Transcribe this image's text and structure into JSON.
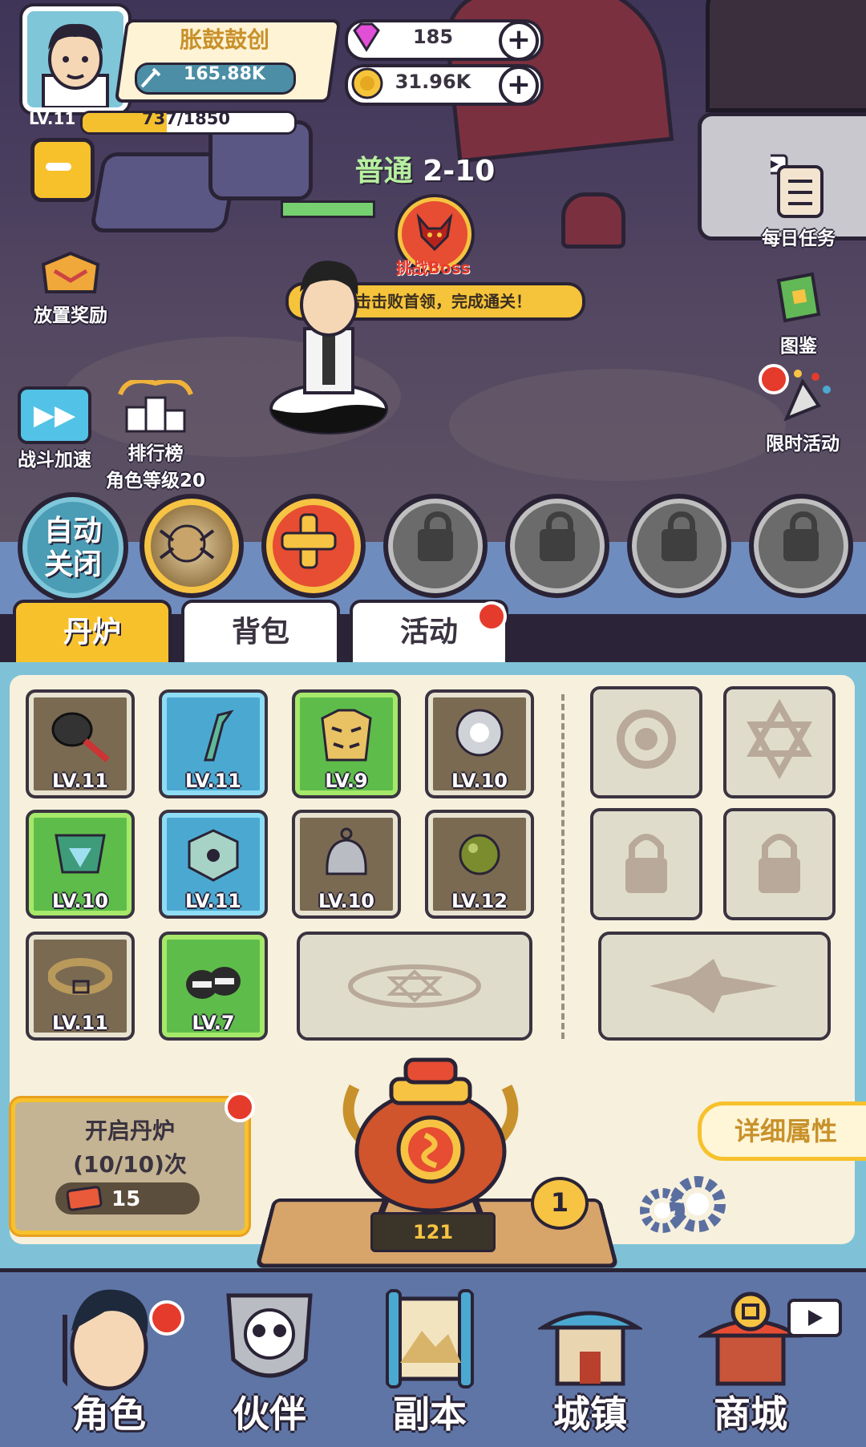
{
  "player": {
    "name": "胀鼓鼓创",
    "power": "165.88K",
    "level": "LV.11",
    "xp_text": "737/1850",
    "xp_fraction": 0.398
  },
  "resources": {
    "gems": "185",
    "gold": "31.96K"
  },
  "stage": {
    "mode": "普通",
    "number": "2-10",
    "boss_label": "挑战Boss",
    "tip": "点击击败首领，完成通关！"
  },
  "side_left": {
    "idle_reward": "放置奖励",
    "battle_speed": "战斗加速",
    "ranking": "排行榜",
    "ranking_sub": "角色等级20"
  },
  "side_right": {
    "daily_tasks": "每日任务",
    "codex": "图鉴",
    "limited_event": "限时活动"
  },
  "auto_button": {
    "line1": "自动",
    "line2": "关闭"
  },
  "tabs": [
    "丹炉",
    "背包",
    "活动"
  ],
  "equipment": [
    {
      "name": "frying-pan",
      "level": "LV.11",
      "rarity": "brown"
    },
    {
      "name": "jade-sword",
      "level": "LV.11",
      "rarity": "blue"
    },
    {
      "name": "tiger-robe",
      "level": "LV.9",
      "rarity": "green"
    },
    {
      "name": "husky-coin",
      "level": "LV.10",
      "rarity": "brown"
    },
    {
      "name": "jade-mirror",
      "level": "LV.10",
      "rarity": "green"
    },
    {
      "name": "jade-disc",
      "level": "LV.11",
      "rarity": "blue"
    },
    {
      "name": "silver-bell",
      "level": "LV.10",
      "rarity": "brown"
    },
    {
      "name": "green-pearl",
      "level": "LV.12",
      "rarity": "brown"
    },
    {
      "name": "leather-belt",
      "level": "LV.11",
      "rarity": "brown"
    },
    {
      "name": "cat-boots",
      "level": "LV.7",
      "rarity": "green"
    }
  ],
  "furnace": {
    "open_label": "开启丹炉",
    "count_label": "(10/10)次",
    "ticket_cost": "15",
    "level_badge": "1",
    "furnace_value": "121",
    "detail_button": "详细属性"
  },
  "bottom_nav": [
    "角色",
    "伙伴",
    "副本",
    "城镇",
    "商城"
  ],
  "colors": {
    "accent_yellow": "#f7c12c",
    "rarity_brown": "#7a6a52",
    "rarity_blue": "#4ba9d1",
    "rarity_green": "#5ebd4a",
    "panel_blue": "#7fc2d7"
  }
}
